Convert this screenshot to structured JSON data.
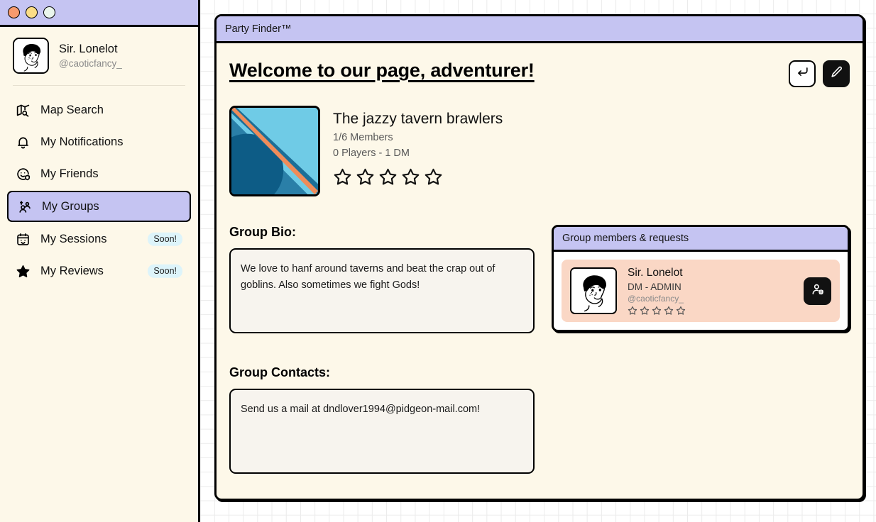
{
  "window_controls": [
    {
      "name": "close",
      "color": "#f79a6d"
    },
    {
      "name": "minimize",
      "color": "#fbdd86"
    },
    {
      "name": "maximize",
      "color": "#eaf6ec"
    }
  ],
  "sidebar": {
    "user": {
      "name": "Sir. Lonelot",
      "handle": "@caoticfancy_",
      "avatar_icon": "user-portrait-avatar"
    },
    "items": [
      {
        "label": "Map Search",
        "icon": "map-search-icon",
        "active": false,
        "badge": ""
      },
      {
        "label": "My Notifications",
        "icon": "bell-icon",
        "active": false,
        "badge": ""
      },
      {
        "label": "My Friends",
        "icon": "smiley-shield-icon",
        "active": false,
        "badge": ""
      },
      {
        "label": "My Groups",
        "icon": "users-group-icon",
        "active": true,
        "badge": ""
      },
      {
        "label": "My Sessions",
        "icon": "calendar-icon",
        "active": false,
        "badge": "Soon!"
      },
      {
        "label": "My Reviews",
        "icon": "star-icon",
        "active": false,
        "badge": "Soon!"
      }
    ]
  },
  "window": {
    "bar_title": "Party Finder™",
    "page_title": "Welcome to our page, adventurer!",
    "actions": [
      {
        "name": "back-button",
        "icon": "return-arrow-icon"
      },
      {
        "name": "edit-button",
        "icon": "pencil-icon"
      }
    ]
  },
  "group": {
    "name": "The jazzy tavern brawlers",
    "members_count": "1/6 Members",
    "composition": "0 Players - 1 DM",
    "rating": 0,
    "rating_max": 5,
    "thumbnail_icon": "group-cover-image",
    "bio_label": "Group Bio:",
    "bio_text": "We love to hanf around taverns and beat the crap out of goblins. Also sometimes we fight Gods!",
    "contacts_label": "Group Contacts:",
    "contacts_text": "Send us a mail at dndlover1994@pidgeon-mail.com!"
  },
  "members_panel": {
    "title": "Group members & requests",
    "members": [
      {
        "name": "Sir. Lonelot",
        "role": "DM - ADMIN",
        "handle": "@caoticfancy_",
        "rating": 0,
        "rating_max": 5,
        "avatar_icon": "user-portrait-avatar",
        "action_icon": "manage-user-icon"
      }
    ]
  },
  "colors": {
    "accent_lavender": "#c5c4f2",
    "page_cream": "#fdf8e9",
    "member_peach": "#fad7c5",
    "badge_cyan": "#ddf4fa",
    "ink": "#000000"
  }
}
